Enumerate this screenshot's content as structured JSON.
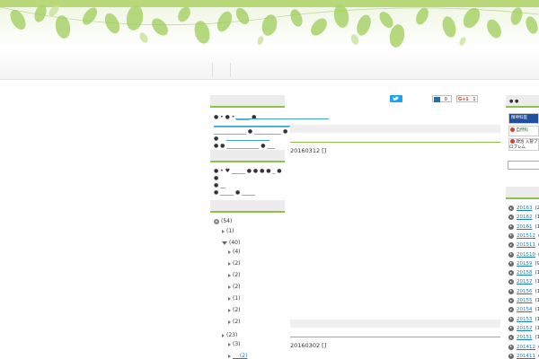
{
  "sidebar": {
    "profile_lines": [
      "● • ●  • _____ ● ____________________________",
      "____________ ● __________ ●",
      "●",
      "● ● ____________ ● ___"
    ],
    "recent_lines": [
      "● • ♥ _____ ● ● ● ● _ ● ●",
      "● __",
      "● _____ ● _____"
    ],
    "archive": [
      {
        "label": "(54)",
        "level": 0,
        "type": "root"
      },
      {
        "label": "(1)",
        "level": 1,
        "type": "node"
      },
      {
        "label": "(40)",
        "level": 1,
        "type": "node"
      },
      {
        "label": "(4)",
        "level": 2,
        "type": "leaf"
      },
      {
        "label": "(2)",
        "level": 2,
        "type": "leaf"
      },
      {
        "label": "(2)",
        "level": 2,
        "type": "leaf"
      },
      {
        "label": "(2)",
        "level": 2,
        "type": "leaf"
      },
      {
        "label": "(1)",
        "level": 2,
        "type": "leaf"
      },
      {
        "label": "(2)",
        "level": 2,
        "type": "leaf"
      },
      {
        "label": "(2)",
        "level": 2,
        "type": "leaf"
      },
      {
        "label": "(23)",
        "level": 1,
        "type": "node"
      },
      {
        "label": "(3)",
        "level": 2,
        "type": "leaf"
      },
      {
        "label": "__ (2)",
        "level": 2,
        "type": "leaf"
      }
    ]
  },
  "posts": [
    {
      "date": "20160312 []"
    },
    {
      "date": "20160302 []"
    }
  ],
  "social": {
    "twitter_label": "",
    "hatena_count": "0",
    "google_label": "G+1",
    "google_count": "1"
  },
  "right": {
    "header": "● ●",
    "banners": [
      "精神科医",
      "自然科",
      "政治 入管プロブレム"
    ],
    "archive": [
      {
        "label": "20163",
        "count": "(2)"
      },
      {
        "label": "20162",
        "count": "(10"
      },
      {
        "label": "20161",
        "count": "(15"
      },
      {
        "label": "201512",
        "count": "(8"
      },
      {
        "label": "201511",
        "count": "(11"
      },
      {
        "label": "201510",
        "count": "(11"
      },
      {
        "label": "20159",
        "count": "(9)"
      },
      {
        "label": "20158",
        "count": "(10"
      },
      {
        "label": "20157",
        "count": "(16"
      },
      {
        "label": "20156",
        "count": "(14"
      },
      {
        "label": "20155",
        "count": "(12"
      },
      {
        "label": "20154",
        "count": "(16"
      },
      {
        "label": "20153",
        "count": "(11"
      },
      {
        "label": "20152",
        "count": "(11"
      },
      {
        "label": "20151",
        "count": "(12"
      },
      {
        "label": "201412",
        "count": "(8"
      },
      {
        "label": "201411",
        "count": "(3"
      }
    ]
  },
  "colors": {
    "accent_green": "#8cc24a",
    "link_blue": "#1a7fc2",
    "twitter_blue": "#1da1f2"
  }
}
